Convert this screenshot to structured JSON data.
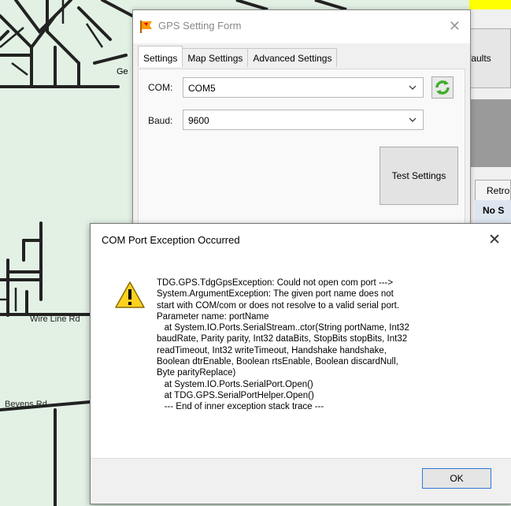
{
  "map": {
    "labels": {
      "wire_line": "Wire Line Rd",
      "bevens": "Bevens Rd",
      "ge": "Ge"
    }
  },
  "background_app": {
    "defaults_label": "faults",
    "retro_tab": "Retro",
    "no_status": "No S"
  },
  "gps_form": {
    "title": "GPS Setting Form",
    "close_glyph": "✕",
    "tabs": [
      {
        "label": "Settings",
        "active": true
      },
      {
        "label": "Map Settings",
        "active": false
      },
      {
        "label": "Advanced Settings",
        "active": false
      }
    ],
    "com_label": "COM:",
    "com_value": "COM5",
    "baud_label": "Baud:",
    "baud_value": "9600",
    "test_button": "Test Settings"
  },
  "dialog": {
    "title": "COM Port Exception Occurred",
    "close_glyph": "✕",
    "icon": "warning-icon",
    "message": "TDG.GPS.TdgGpsException: Could not open com port --->\nSystem.ArgumentException: The given port name does not\nstart with COM/com or does not resolve to a valid serial port.\nParameter name: portName\n   at System.IO.Ports.SerialStream..ctor(String portName, Int32\nbaudRate, Parity parity, Int32 dataBits, StopBits stopBits, Int32\nreadTimeout, Int32 writeTimeout, Handshake handshake,\nBoolean dtrEnable, Boolean rtsEnable, Boolean discardNull,\nByte parityReplace)\n   at System.IO.Ports.SerialPort.Open()\n   at TDG.GPS.SerialPortHelper.Open()\n   --- End of inner exception stack trace ---",
    "ok_button": "OK"
  },
  "colors": {
    "map_bg": "#e2f1e4",
    "road": "#222222",
    "accent_border": "#2d78d6",
    "warning_fill": "#ffd21f"
  }
}
